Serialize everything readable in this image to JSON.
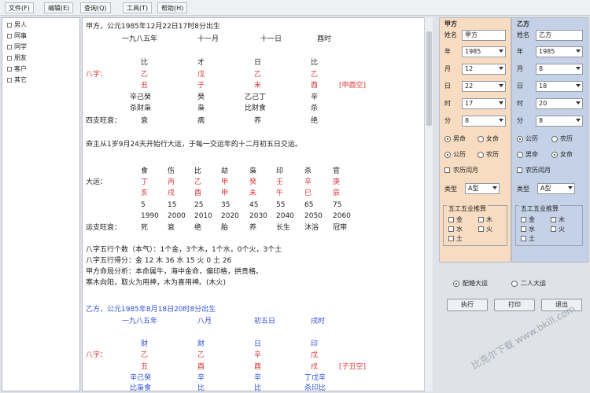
{
  "menu": [
    "文件(F)",
    "编辑(E)",
    "查询(Q)",
    "工具(T)",
    "帮助(H)"
  ],
  "tree": [
    "男人",
    "同事",
    "同学",
    "朋友",
    "客户",
    "其它"
  ],
  "doc": {
    "a_header": "甲方，公元1985年12月22日17时8分出生",
    "a_lunar": [
      "一九八五年",
      "十一月",
      "十一日",
      "酉时"
    ],
    "a_gods": [
      "比",
      "才",
      "日",
      "比"
    ],
    "bazi_label": "八字：",
    "a_stems": [
      "乙",
      "戊",
      "乙",
      "乙"
    ],
    "a_branches": [
      "丑",
      "子",
      "未",
      "酉"
    ],
    "a_void": "[申酉空]",
    "a_hidden1": [
      "辛己癸",
      "癸",
      "乙己丁",
      "辛"
    ],
    "a_hidden2": [
      "杀财枭",
      "枭",
      "比财食",
      "杀"
    ],
    "state_label": "四支旺衰：",
    "a_state": [
      "衰",
      "病",
      "养",
      "绝"
    ],
    "luck_text": "命主从1岁9月24天开始行大运，于每一交运年的十二月初五日交运。",
    "luck_gods": [
      "食",
      "伤",
      "比",
      "劫",
      "枭",
      "印",
      "杀",
      "官"
    ],
    "luck_label": "大运：",
    "luck_stems": [
      "丁",
      "丙",
      "乙",
      "甲",
      "癸",
      "壬",
      "辛",
      "庚"
    ],
    "luck_branches": [
      "亥",
      "戌",
      "酉",
      "申",
      "未",
      "午",
      "巳",
      "辰"
    ],
    "luck_ages": [
      "5",
      "15",
      "25",
      "35",
      "45",
      "55",
      "65",
      "75"
    ],
    "luck_years": [
      "1990",
      "2000",
      "2010",
      "2020",
      "2030",
      "2040",
      "2050",
      "2060"
    ],
    "luck_state_label": "运支旺衰：",
    "luck_state": [
      "死",
      "衰",
      "绝",
      "胎",
      "养",
      "长生",
      "沐浴",
      "冠带"
    ],
    "five_count": "八字五行个数（本气）：1个金，3个木，1个水，0个火，3个土",
    "five_score": "八字五行得分：金 12  木 36  水 15  火 0  土 26",
    "analysis1": "甲方命局分析：本命属牛，海中金命，偏印格，拱贵格。",
    "analysis2": "寒木向阳，取火为用神，木为喜用神。(木火)",
    "b_header": "乙方，公元1985年8月18日20时8分出生",
    "b_lunar": [
      "一九八五年",
      "八月",
      "初五日",
      "戌时"
    ],
    "b_gods": [
      "财",
      "财",
      "日",
      "印"
    ],
    "b_stems": [
      "乙",
      "乙",
      "辛",
      "戊"
    ],
    "b_branches": [
      "丑",
      "酉",
      "酉",
      "戌"
    ],
    "b_void": "[子丑空]",
    "b_hidden1": [
      "辛己癸",
      "辛",
      "辛",
      "丁戊辛"
    ],
    "b_hidden2": [
      "比枭食",
      "比",
      "比",
      "杀印比"
    ]
  },
  "party_a": {
    "title": "甲方",
    "name_label": "姓名",
    "name": "甲方",
    "year_label": "年",
    "year": "1985",
    "month_label": "月",
    "month": "12",
    "day_label": "日",
    "day": "22",
    "hour_label": "时",
    "hour": "17",
    "minute_label": "分",
    "minute": "8",
    "gender": [
      "男命",
      "女命"
    ],
    "calendar": [
      "公历",
      "农历"
    ],
    "leap_label": "农历闰月",
    "type_label": "类型",
    "type": "A型",
    "group_title": "五工五业推算",
    "checks": [
      "金",
      "木",
      "水",
      "火",
      "土"
    ]
  },
  "party_b": {
    "title": "乙方",
    "name_label": "姓名",
    "name": "乙方",
    "year_label": "年",
    "year": "1985",
    "month_label": "月",
    "month": "8",
    "day_label": "日",
    "day": "18",
    "hour_label": "时",
    "hour": "20",
    "minute_label": "分",
    "minute": "8",
    "gender": [
      "男命",
      "女命"
    ],
    "calendar": [
      "公历",
      "农历"
    ],
    "leap_label": "农历闰月",
    "type_label": "类型",
    "type": "A型",
    "group_title": "五工五业推算",
    "checks": [
      "金",
      "木",
      "水",
      "火",
      "土"
    ]
  },
  "mode": [
    "配婚大运",
    "二人大运"
  ],
  "buttons": [
    "执行",
    "打印",
    "退出"
  ],
  "watermark": "比克尔下载 www.bkill.com"
}
